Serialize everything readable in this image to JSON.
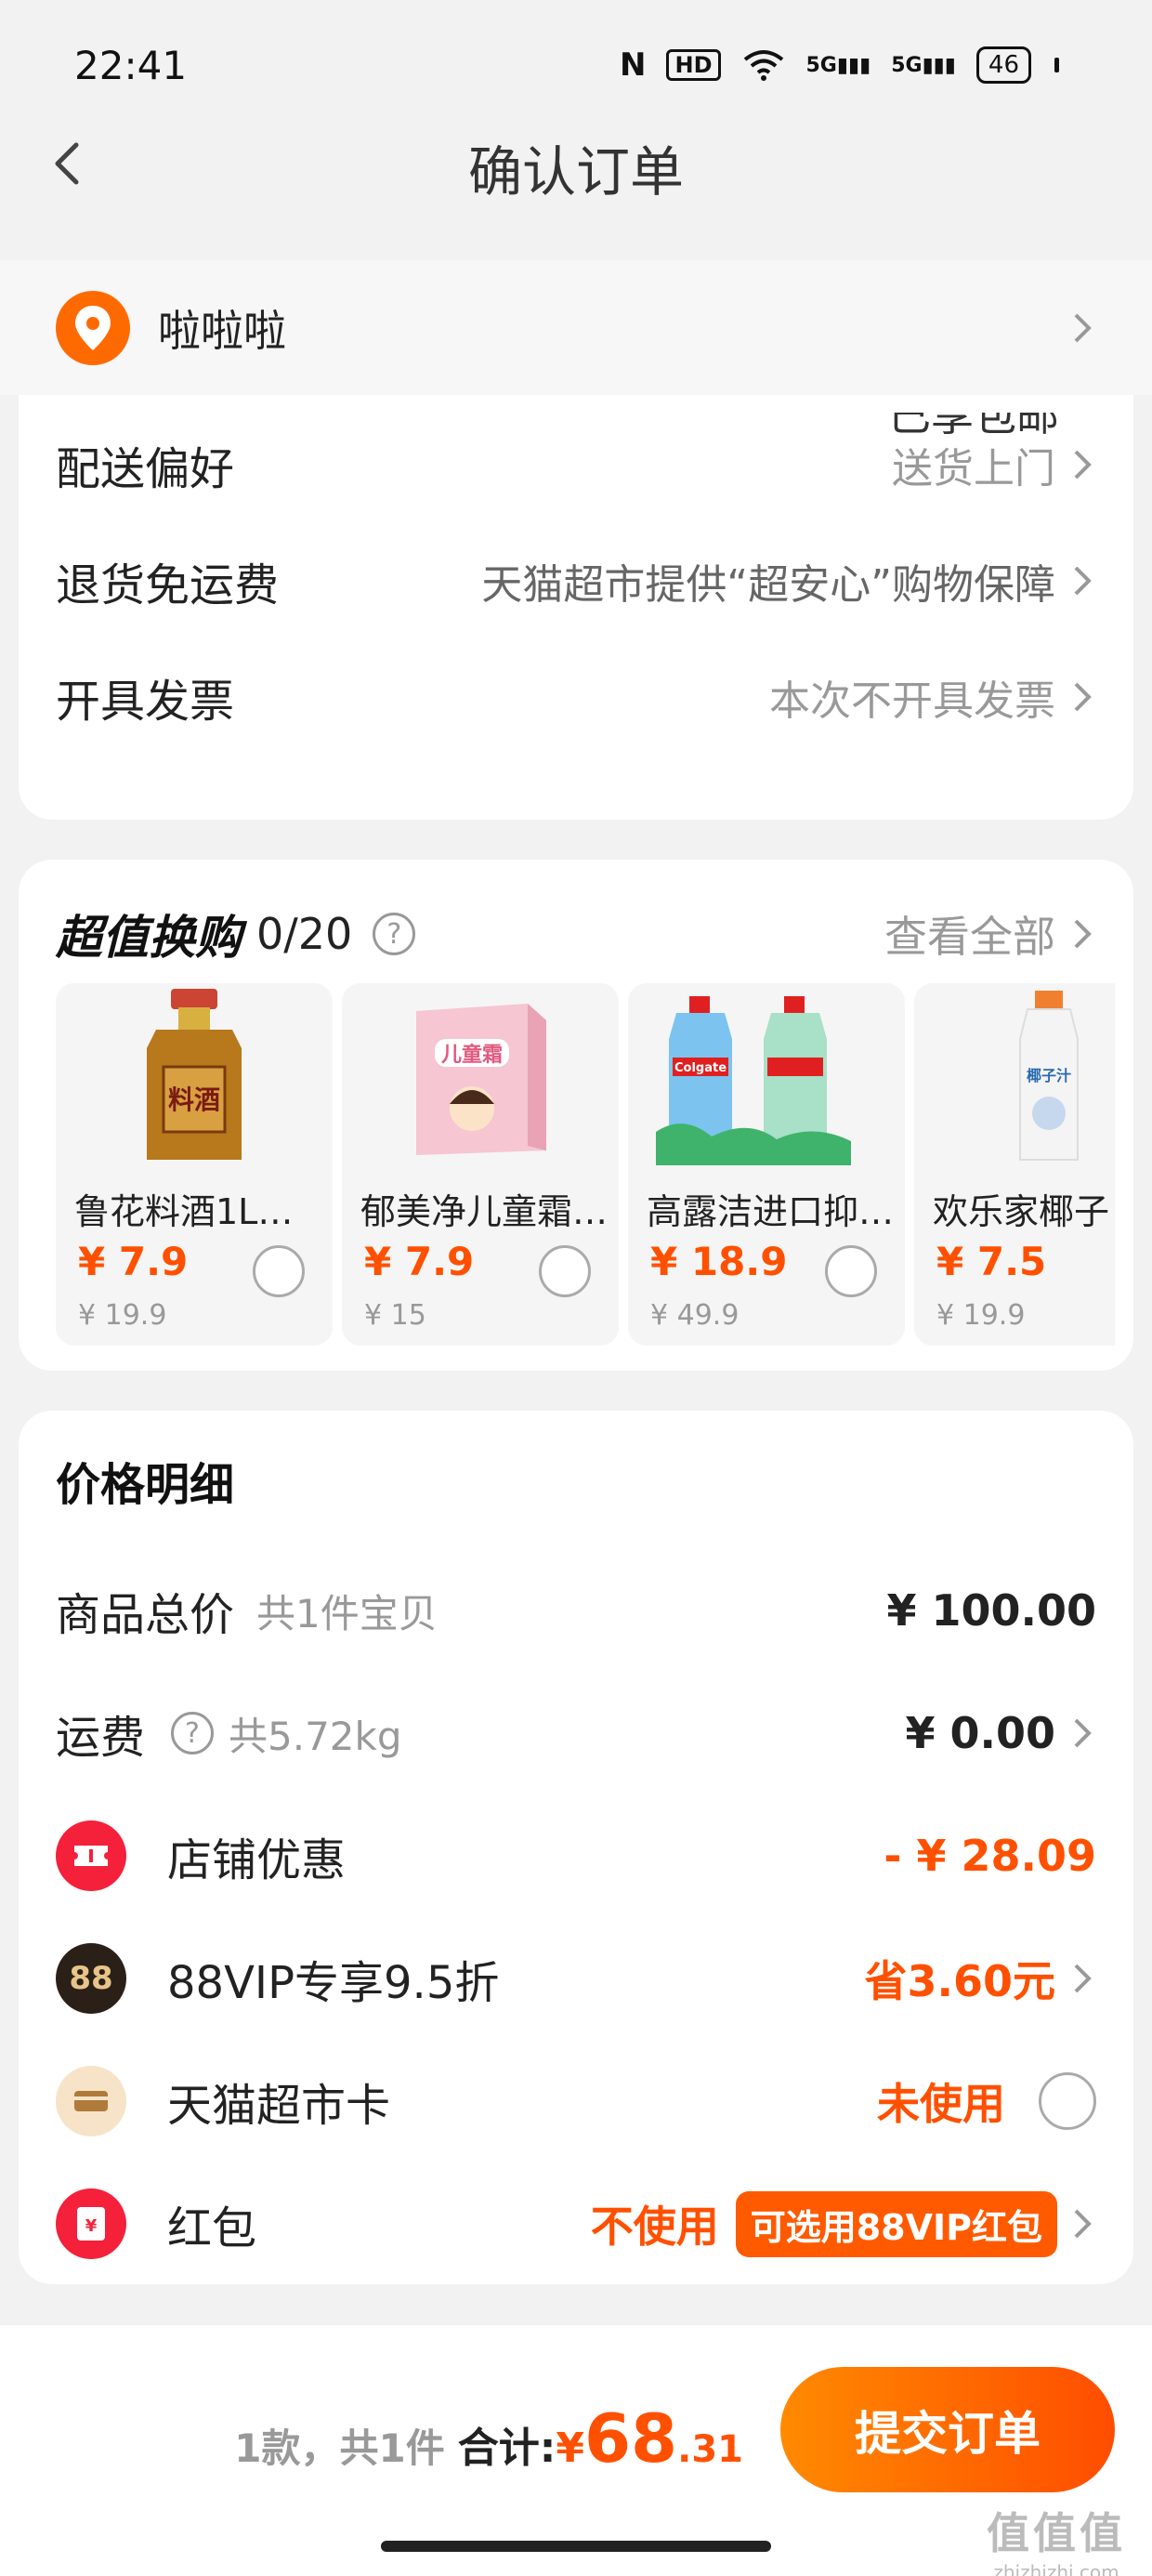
{
  "status_bar": {
    "time": "22:41",
    "hd_label": "HD",
    "signal_1": "5G",
    "signal_2": "5G",
    "battery": "46"
  },
  "nav": {
    "title": "确认订单"
  },
  "address": {
    "name": "啦啦啦"
  },
  "delivery_card": {
    "cut_text": "已享包邮",
    "rows": [
      {
        "label": "配送偏好",
        "value": "送货上门"
      },
      {
        "label": "退货免运费",
        "value": "天猫超市提供“超安心”购物保障"
      },
      {
        "label": "开具发票",
        "value": "本次不开具发票"
      }
    ]
  },
  "swap": {
    "title": "超值换购",
    "count": "0/20",
    "help": "?",
    "view_all": "查看全部",
    "products": [
      {
        "name": "鲁花料酒1L非…",
        "price": "¥ 7.9",
        "original": "¥ 19.9",
        "img_label": "料酒"
      },
      {
        "name": "郁美净儿童霜…",
        "price": "¥ 7.9",
        "original": "¥ 15",
        "img_label": "儿童霜"
      },
      {
        "name": "高露洁进口抑…",
        "price": "¥ 18.9",
        "original": "¥ 49.9",
        "img_label": "Colgate"
      },
      {
        "name": "欢乐家椰子",
        "price": "¥ 7.5",
        "original": "¥ 19.9",
        "img_label": "椰子汁"
      }
    ]
  },
  "price_detail": {
    "title": "价格明细",
    "goods_total": {
      "label": "商品总价",
      "sub": "共1件宝贝",
      "value": "¥ 100.00"
    },
    "shipping": {
      "label": "运费",
      "sub": "共5.72kg",
      "value": "¥ 0.00"
    },
    "store_discount": {
      "label": "店铺优惠",
      "value": "- ¥ 28.09"
    },
    "vip": {
      "icon_text": "88",
      "label": "88VIP专享9.5折",
      "value": "省3.60元"
    },
    "card": {
      "label": "天猫超市卡",
      "value": "未使用"
    },
    "red_packet": {
      "icon_text": "¥",
      "label": "红包",
      "value": "不使用",
      "pill": "可选用88VIP红包"
    }
  },
  "footer": {
    "count": "1款，共1件",
    "total_label": "合计:",
    "yen": "¥",
    "total_int": "68",
    "total_dec": ".31",
    "submit": "提交订单"
  },
  "watermark": {
    "big": "值值值",
    "small": "zhizhizhi.com"
  },
  "colors": {
    "accent": "#ff5000",
    "background": "#f2f2f2"
  }
}
